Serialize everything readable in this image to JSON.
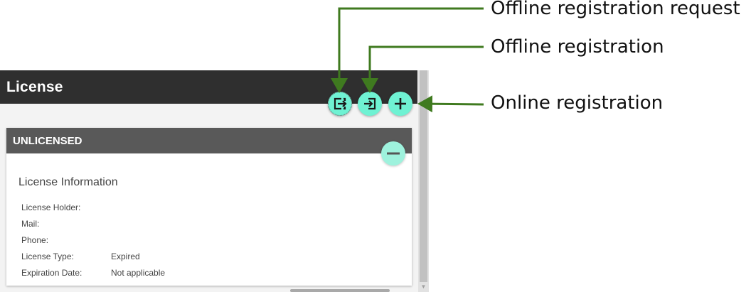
{
  "window": {
    "title": "License"
  },
  "actions": {
    "offline_request": {
      "icon": "export-icon"
    },
    "offline_registration": {
      "icon": "import-icon"
    },
    "online_registration": {
      "icon": "plus-icon"
    }
  },
  "card": {
    "status": "UNLICENSED",
    "collapse_icon": "minus-icon",
    "section_title": "License Information",
    "fields": [
      {
        "label": "License Holder:",
        "value": ""
      },
      {
        "label": "Mail:",
        "value": ""
      },
      {
        "label": "Phone:",
        "value": ""
      },
      {
        "label": "License Type:",
        "value": "Expired"
      },
      {
        "label": "Expiration Date:",
        "value": "Not applicable"
      }
    ]
  },
  "callouts": [
    {
      "text": "Offline registration request"
    },
    {
      "text": "Offline registration"
    },
    {
      "text": "Online registration"
    }
  ],
  "colors": {
    "accent": "#6ff2d3",
    "title_bar": "#2f2f2f",
    "card_header": "#595959",
    "callout_line": "#3f7a1f"
  }
}
